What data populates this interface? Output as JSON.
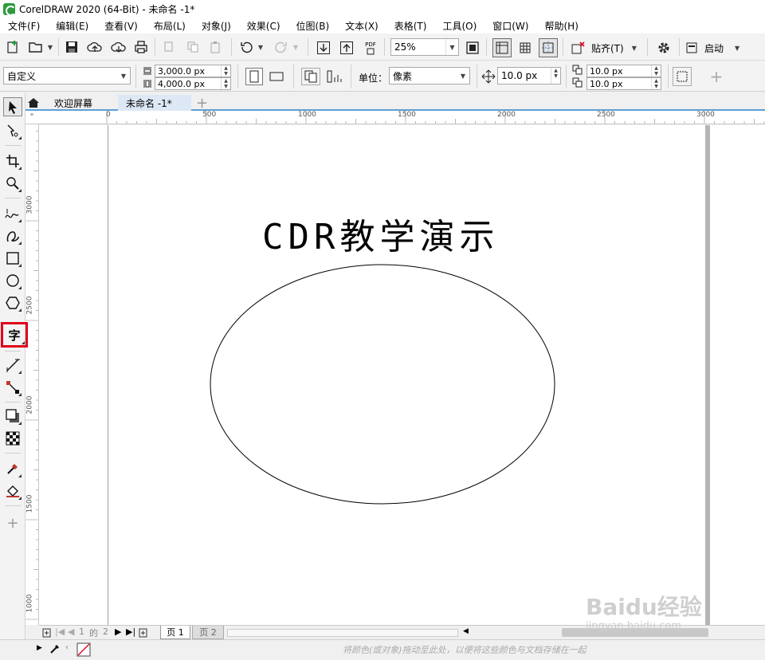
{
  "window": {
    "title": "CorelDRAW 2020 (64-Bit) - 未命名 -1*"
  },
  "menu": [
    "文件(F)",
    "编辑(E)",
    "查看(V)",
    "布局(L)",
    "对象(J)",
    "效果(C)",
    "位图(B)",
    "文本(X)",
    "表格(T)",
    "工具(O)",
    "窗口(W)",
    "帮助(H)"
  ],
  "toolbar": {
    "zoom": "25%",
    "snap_label": "贴齐(T)",
    "launch_label": "启动",
    "pdf_label": "PDF"
  },
  "property_bar": {
    "preset": "自定义",
    "width": "3,000.0 px",
    "height": "4,000.0 px",
    "units_label": "单位：",
    "units": "像素",
    "nudge": "10.0 px",
    "dup_x": "10.0 px",
    "dup_y": "10.0 px"
  },
  "tabs": {
    "welcome": "欢迎屏幕",
    "document": "未命名 -1*"
  },
  "ruler": {
    "h_ticks": [
      "0",
      "500",
      "1000",
      "1500",
      "2000",
      "2500",
      "3000"
    ],
    "v_ticks": [
      "3000",
      "2500",
      "2000",
      "1500",
      "1000"
    ],
    "corner_icon": "ruler-origin-icon"
  },
  "canvas": {
    "title_text": "CDR教学演示"
  },
  "page_nav": {
    "current": "1",
    "of_label": "的",
    "total": "2",
    "page1": "页 1",
    "page2": "页 2"
  },
  "status": {
    "hint": "将颜色(或对象)拖动至此处，以便将这些颜色与文档存储在一起"
  },
  "watermark": {
    "line1": "Baidu经验",
    "line2": "jingyan.baidu.com"
  },
  "colors": {
    "accent": "#5aa0d8",
    "highlight": "#e0001b",
    "logo": "#2e9a3e"
  }
}
